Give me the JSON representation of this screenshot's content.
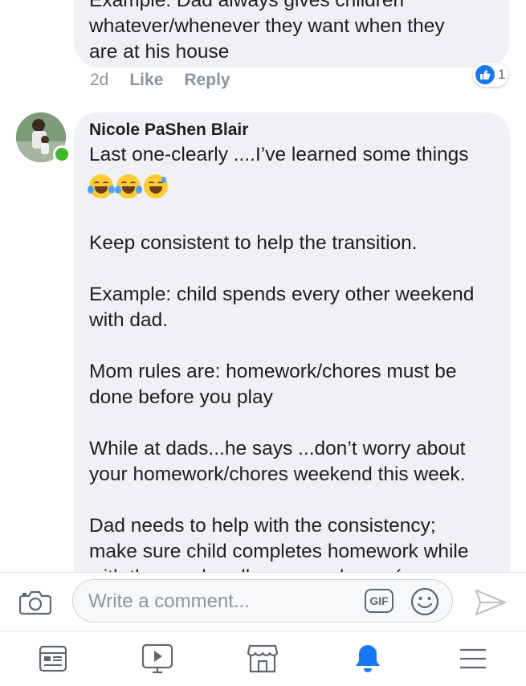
{
  "comment1": {
    "lines": [
      "Example: Dad always gives children",
      "whatever/whenever they want when they",
      "are at his house"
    ],
    "time": "2d",
    "like_label": "Like",
    "reply_label": "Reply",
    "reaction_count": "1"
  },
  "comment2": {
    "author": "Nicole PaShen Blair",
    "first_line": "Last one-clearly ....I’ve  learned some things",
    "paragraphs": [
      [
        "Keep consistent to help the transition."
      ],
      [
        "Example: child spends every other weekend",
        "with dad."
      ],
      [
        "Mom rules are: homework/chores must be",
        "done before you play"
      ],
      [
        "While at dads...he says ...don’t worry about",
        "your homework/chores  weekend this week."
      ],
      [
        "Dad needs to help with the consistency;",
        "make sure child completes homework while",
        "with them or handles same chores (or any"
      ]
    ]
  },
  "composer": {
    "placeholder": "Write a comment...",
    "gif_label": "GIF"
  },
  "nav": {
    "items": [
      "news-feed",
      "watch",
      "marketplace",
      "notifications",
      "menu"
    ],
    "active": "notifications"
  },
  "colors": {
    "bubble": "#f0f1f4",
    "accent": "#1877f2",
    "online": "#42b72a",
    "meta_text": "#8d949e"
  }
}
